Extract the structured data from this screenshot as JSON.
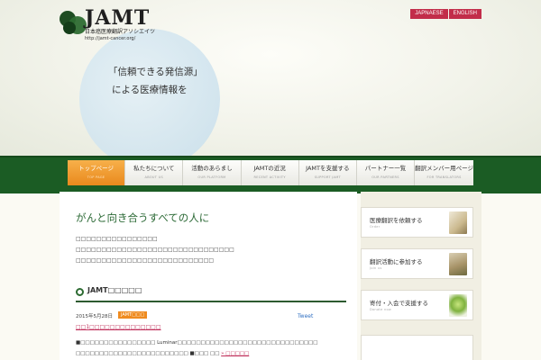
{
  "header": {
    "logo_text": "JAMT",
    "logo_subtitle": "日本癌医療翻訳アソシエイツ",
    "logo_url": "http://jamt-cancer.org/",
    "lang_ja": "JAPNAESE",
    "lang_en": "ENGLISH",
    "catch_line1": "「信頼できる発信源」",
    "catch_line2": "による医療情報を"
  },
  "nav": {
    "items": [
      {
        "ja": "トップページ",
        "en": "TOP PAGE"
      },
      {
        "ja": "私たちについて",
        "en": "ABOUT US"
      },
      {
        "ja": "活動のあらまし",
        "en": "OUR PLATFORM"
      },
      {
        "ja": "JAMTの近況",
        "en": "RECENT ACTIVITY"
      },
      {
        "ja": "JAMTを支援する",
        "en": "SUPPORT JAMT"
      },
      {
        "ja": "パートナー一覧",
        "en": "OUR PARTNERS"
      },
      {
        "ja": "翻訳メンバー用ページ",
        "en": "FOR TRANSLATORS"
      }
    ]
  },
  "main": {
    "title": "がんと向き合うすべての人に",
    "intro_1": "□□□□□□□□□□□□□□□□",
    "intro_2": "□□□□□□□□□□□□□□□□□□□□□□□□□□□□□□□",
    "intro_3": "□□□□□□□□□□□□□□□□□□□□□□□□□□□",
    "section_title": "JAMT□□□□□",
    "news": {
      "date": "2015年5月28日",
      "badge": "JAMT□□□",
      "tweet": "Tweet",
      "link": "□□1□□□□□□□□□□□□□□",
      "body_1": "■□□□□□□□□□□□□□□□□ Luminar□□□□□□□□□□□□□□□□□□□□□□□□□□□□□□",
      "body_2": "□□□□□□□□□□□□□□□□□□□□□□□□ ■□□□ □□",
      "more": "» □□□□□"
    }
  },
  "sidebar": {
    "buttons": [
      {
        "title": "医療翻訳を依頼する",
        "en": "Order"
      },
      {
        "title": "翻訳活動に参加する",
        "en": "Join us"
      },
      {
        "title": "寄付・入会で支援する",
        "en": "Donate now"
      }
    ]
  }
}
